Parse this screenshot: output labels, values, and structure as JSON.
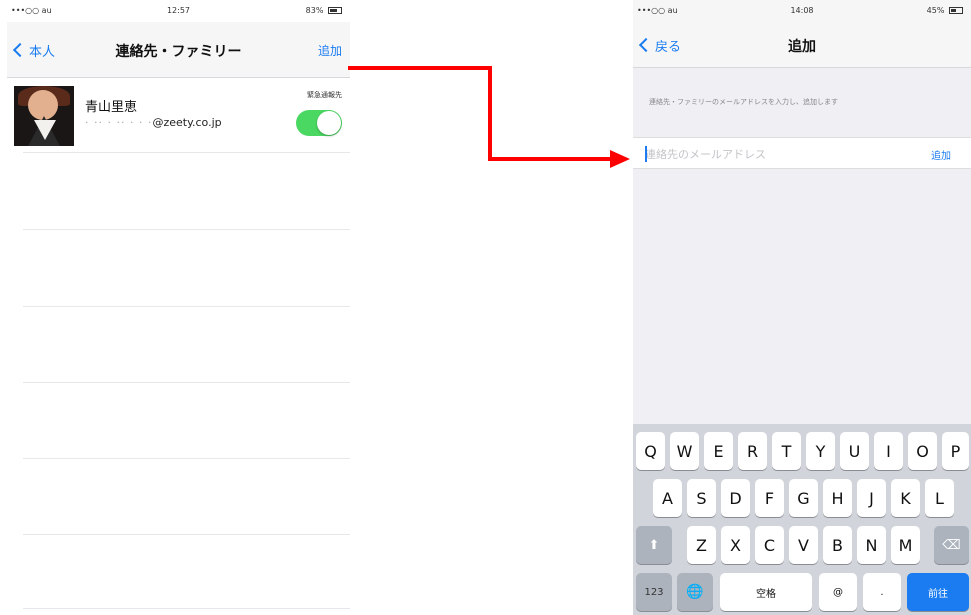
{
  "screen1": {
    "status": {
      "carrier": "•••○○ au",
      "time": "12:57",
      "battery": "83%"
    },
    "nav": {
      "back_label": "本人",
      "title": "連絡先・ファミリー",
      "right_label": "追加"
    },
    "contact": {
      "name": "青山里恵",
      "email_masked": "· ·· · ·· · · ·",
      "email_domain": "@zeety.co.jp",
      "emergency_label": "緊急通報先",
      "emergency_on": true
    }
  },
  "screen2": {
    "status": {
      "carrier": "•••○○ au",
      "time": "14:08",
      "battery": "45%"
    },
    "nav": {
      "back_label": "戻る",
      "title": "追加"
    },
    "instruction": "連絡先・ファミリーのメールアドレスを入力し、追加します",
    "email_field": {
      "placeholder": "連絡先のメールアドレス",
      "value": ""
    },
    "add_label": "追加",
    "keyboard": {
      "row1": [
        "Q",
        "W",
        "E",
        "R",
        "T",
        "Y",
        "U",
        "I",
        "O",
        "P"
      ],
      "row2": [
        "A",
        "S",
        "D",
        "F",
        "G",
        "H",
        "J",
        "K",
        "L"
      ],
      "row3": [
        "Z",
        "X",
        "C",
        "V",
        "B",
        "N",
        "M"
      ],
      "numbers_label": "123",
      "space_label": "空格",
      "at_label": "@",
      "dot_label": ".",
      "return_label": "前往"
    }
  },
  "colors": {
    "accent": "#1a7cf0",
    "toggle_on": "#4bd862",
    "arrow": "#ff0000"
  }
}
